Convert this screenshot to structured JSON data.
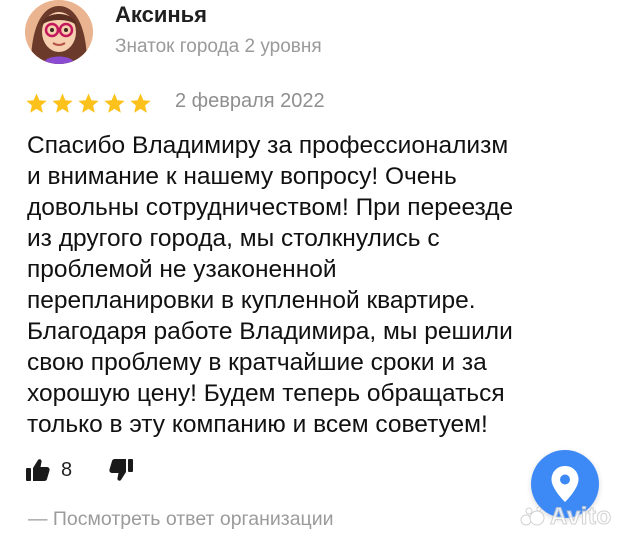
{
  "author": {
    "name": "Аксинья",
    "status": "Знаток города 2 уровня",
    "avatar_icon": "avatar-woman-glasses"
  },
  "review": {
    "rating": 5,
    "max_rating": 5,
    "date": "2 февраля 2022",
    "text": "Спасибо Владимиру за профессионализм\nи внимание к нашему вопросу! Очень\nдовольны сотрудничеством! При переезде\nиз другого города, мы столкнулись с\nпроблемой не узаконенной\nперепланировки в купленной квартире.\nБлагодаря работе Владимира, мы решили\nсвою проблему в кратчайшие сроки и за\nхорошую цену! Будем теперь обращаться\nтолько в эту компанию и всем советуем!"
  },
  "actions": {
    "like_count": "8",
    "like_icon": "thumbs-up-icon",
    "dislike_icon": "thumbs-down-icon",
    "reply_link": "— Посмотреть ответ организации"
  },
  "fab": {
    "icon": "map-pin-icon"
  },
  "watermark": {
    "text": "Avito"
  },
  "colors": {
    "star": "#fcc21b",
    "fab": "#3d8af7",
    "muted": "#9b9b9b"
  }
}
